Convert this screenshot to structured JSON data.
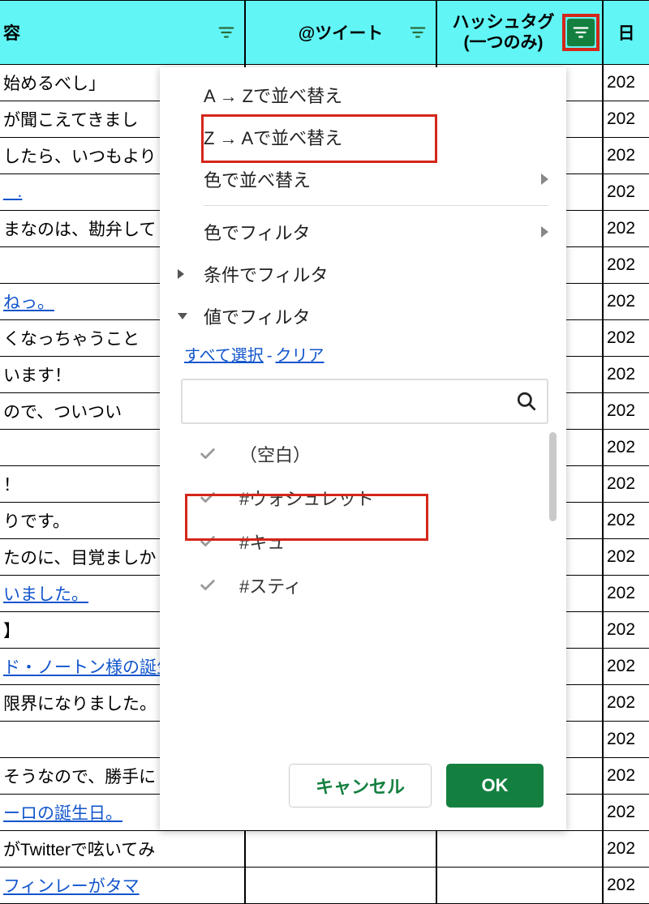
{
  "header": {
    "content": "容",
    "tweet": "@ツイート",
    "hashtag_line1": "ハッシュタグ",
    "hashtag_line2": "(一つのみ)",
    "date": "日"
  },
  "rows": [
    {
      "content": "始めるべし」",
      "date": "202",
      "link": false
    },
    {
      "content": "が聞こえてきまし",
      "date": "202",
      "link": false
    },
    {
      "content": "したら、いつもより",
      "date": "202",
      "link": false
    },
    {
      "content": "_ .",
      "date": "202",
      "link": true
    },
    {
      "content": "まなのは、勘弁して",
      "date": "202",
      "link": false
    },
    {
      "content": "",
      "date": "202",
      "link": false
    },
    {
      "content": "ねっ。",
      "date": "202",
      "link": true
    },
    {
      "content": "くなっちゃうこと",
      "date": "202",
      "link": false
    },
    {
      "content": "います！",
      "date": "202",
      "link": false
    },
    {
      "content": "ので、ついつい",
      "date": "202",
      "link": false
    },
    {
      "content": "",
      "date": "202",
      "link": false
    },
    {
      "content": "！",
      "date": "202",
      "link": false
    },
    {
      "content": "りです。",
      "date": "202",
      "link": false
    },
    {
      "content": "たのに、目覚ましか",
      "date": "202",
      "link": false
    },
    {
      "content": "いました。",
      "date": "202",
      "link": true
    },
    {
      "content": "】",
      "date": "202",
      "link": false
    },
    {
      "content": "ド・ノートン様の誕生",
      "date": "202",
      "link": true
    },
    {
      "content": "限界になりました。",
      "date": "202",
      "link": false
    },
    {
      "content": "",
      "date": "202",
      "link": false
    },
    {
      "content": "そうなので、勝手に",
      "date": "202",
      "link": false
    },
    {
      "content": "ーロの誕生日。",
      "date": "202",
      "link": true
    },
    {
      "content": "がTwitterで呟いてみ",
      "date": "202",
      "link": false
    },
    {
      "content": "フィンレーがタマ",
      "date": "202",
      "link": true
    }
  ],
  "menu": {
    "sort_az": "A → Zで並べ替え",
    "sort_za": "Z → Aで並べ替え",
    "sort_color": "色で並べ替え",
    "filter_color": "色でフィルタ",
    "filter_condition": "条件でフィルタ",
    "filter_value": "値でフィルタ",
    "select_all": "すべて選択",
    "clear": "クリア",
    "values": [
      "（空白）",
      "#ウォシュレット",
      "#キュ",
      "#スティ"
    ],
    "cancel": "キャンセル",
    "ok": "OK"
  }
}
